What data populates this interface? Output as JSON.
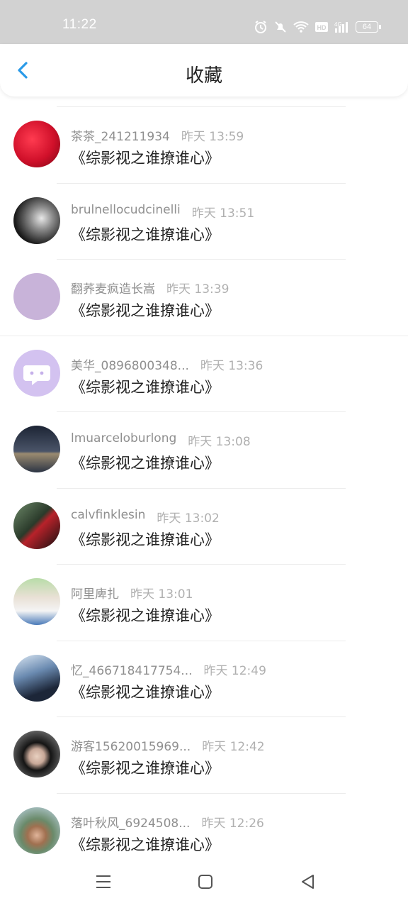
{
  "status": {
    "time": "11:22",
    "battery": "64"
  },
  "header": {
    "title": "收藏"
  },
  "items": [
    {
      "user": "茶茶_241211934",
      "time": "昨天 13:59",
      "title": "《综影视之谁撩谁心》"
    },
    {
      "user": "brulnellocudcinelli",
      "time": "昨天 13:51",
      "title": "《综影视之谁撩谁心》"
    },
    {
      "user": "翻荞麦疯造长嵩",
      "time": "昨天 13:39",
      "title": "《综影视之谁撩谁心》"
    },
    {
      "user": "美华_0896800348...",
      "time": "昨天 13:36",
      "title": "《综影视之谁撩谁心》"
    },
    {
      "user": "lmuarceloburlong",
      "time": "昨天 13:08",
      "title": "《综影视之谁撩谁心》"
    },
    {
      "user": "calvfinklesin",
      "time": "昨天 13:02",
      "title": "《综影视之谁撩谁心》"
    },
    {
      "user": "阿里庳扎",
      "time": "昨天 13:01",
      "title": "《综影视之谁撩谁心》"
    },
    {
      "user": "忆_466718417754...",
      "time": "昨天 12:49",
      "title": "《综影视之谁撩谁心》"
    },
    {
      "user": "游客15620015969...",
      "time": "昨天 12:42",
      "title": "《综影视之谁撩谁心》"
    },
    {
      "user": "落叶秋风_6924508...",
      "time": "昨天 12:26",
      "title": "《综影视之谁撩谁心》"
    }
  ],
  "colors": {
    "accent": "#2a9ae8",
    "status_bar": "#d2d2d2"
  }
}
